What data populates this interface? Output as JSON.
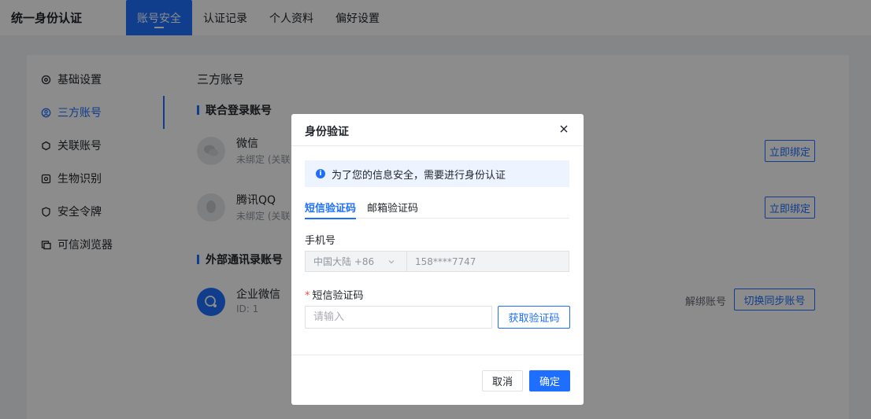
{
  "app": {
    "title": "统一身份认证"
  },
  "nav": {
    "tabs": [
      {
        "label": "账号安全",
        "active": true
      },
      {
        "label": "认证记录",
        "active": false
      },
      {
        "label": "个人资料",
        "active": false
      },
      {
        "label": "偏好设置",
        "active": false
      }
    ]
  },
  "sidebar": {
    "items": [
      {
        "label": "基础设置",
        "icon": "gear-icon"
      },
      {
        "label": "三方账号",
        "icon": "account-icon",
        "active": true
      },
      {
        "label": "关联账号",
        "icon": "link-icon"
      },
      {
        "label": "生物识别",
        "icon": "face-scan-icon"
      },
      {
        "label": "安全令牌",
        "icon": "shield-icon"
      },
      {
        "label": "可信浏览器",
        "icon": "browser-icon"
      }
    ]
  },
  "main": {
    "page_title": "三方账号",
    "section_login": "联合登录账号",
    "section_external": "外部通讯录账号",
    "accounts": [
      {
        "name": "微信",
        "status": "未绑定 (关联",
        "action": "立即绑定"
      },
      {
        "name": "腾讯QQ",
        "status": "未绑定 (关联",
        "action": "立即绑定"
      }
    ],
    "external": {
      "name": "企业微信",
      "id_text": "ID: 1",
      "unbind": "解绑账号",
      "switch_sync": "切换同步账号"
    }
  },
  "modal": {
    "title": "身份验证",
    "notice": "为了您的信息安全，需要进行身份认证",
    "tabs": [
      {
        "label": "短信验证码",
        "active": true
      },
      {
        "label": "邮箱验证码",
        "active": false
      }
    ],
    "phone_label": "手机号",
    "country_value": "中国大陆 +86",
    "phone_value": "158****7747",
    "code_label": "短信验证码",
    "required_mark": "*",
    "code_placeholder": "请输入",
    "get_code": "获取验证码",
    "cancel": "取消",
    "confirm": "确定"
  },
  "colors": {
    "accent": "#1e6fff",
    "required": "#f54a45"
  }
}
